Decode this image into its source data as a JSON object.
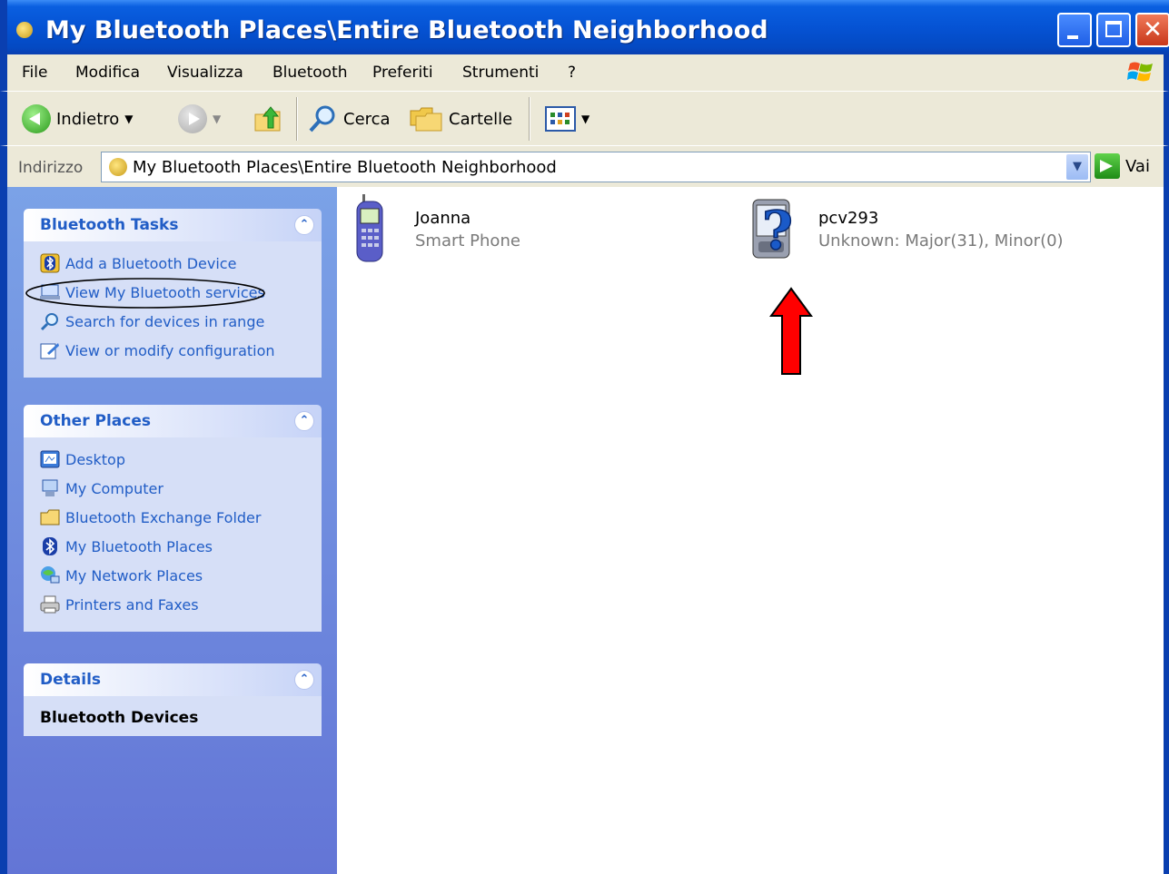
{
  "window": {
    "title": "My Bluetooth Places\\Entire Bluetooth Neighborhood",
    "controls": [
      "minimize",
      "maximize",
      "close"
    ]
  },
  "menu": {
    "items": [
      "File",
      "Modifica",
      "Visualizza",
      "Bluetooth",
      "Preferiti",
      "Strumenti",
      "?"
    ]
  },
  "toolbar": {
    "back_label": "Indietro",
    "search_label": "Cerca",
    "folders_label": "Cartelle"
  },
  "address": {
    "label": "Indirizzo",
    "value": "My Bluetooth Places\\Entire Bluetooth Neighborhood",
    "go_label": "Vai"
  },
  "left_pane": {
    "bluetooth_tasks": {
      "title": "Bluetooth Tasks",
      "items": [
        {
          "label": "Add a Bluetooth Device",
          "icon": "bluetooth-add-icon"
        },
        {
          "label": "View My Bluetooth services",
          "icon": "bluetooth-services-icon"
        },
        {
          "label": "Search for devices in range",
          "icon": "search-icon"
        },
        {
          "label": "View or modify configuration",
          "icon": "configuration-icon"
        }
      ]
    },
    "other_places": {
      "title": "Other Places",
      "items": [
        {
          "label": "Desktop",
          "icon": "desktop-icon"
        },
        {
          "label": "My Computer",
          "icon": "computer-icon"
        },
        {
          "label": "Bluetooth Exchange Folder",
          "icon": "folder-icon"
        },
        {
          "label": "My Bluetooth Places",
          "icon": "bluetooth-icon"
        },
        {
          "label": "My Network Places",
          "icon": "network-icon"
        },
        {
          "label": "Printers and Faxes",
          "icon": "printer-icon"
        }
      ]
    },
    "details": {
      "title": "Details",
      "text": "Bluetooth Devices"
    }
  },
  "devices": [
    {
      "name": "Joanna",
      "type": "Smart Phone",
      "icon": "mobile-phone-icon"
    },
    {
      "name": "pcv293",
      "type": "Unknown: Major(31), Minor(0)",
      "icon": "unknown-device-icon"
    }
  ],
  "annotations": {
    "arrow_color": "#ff0000",
    "ellipse_target": "View My Bluetooth services"
  }
}
